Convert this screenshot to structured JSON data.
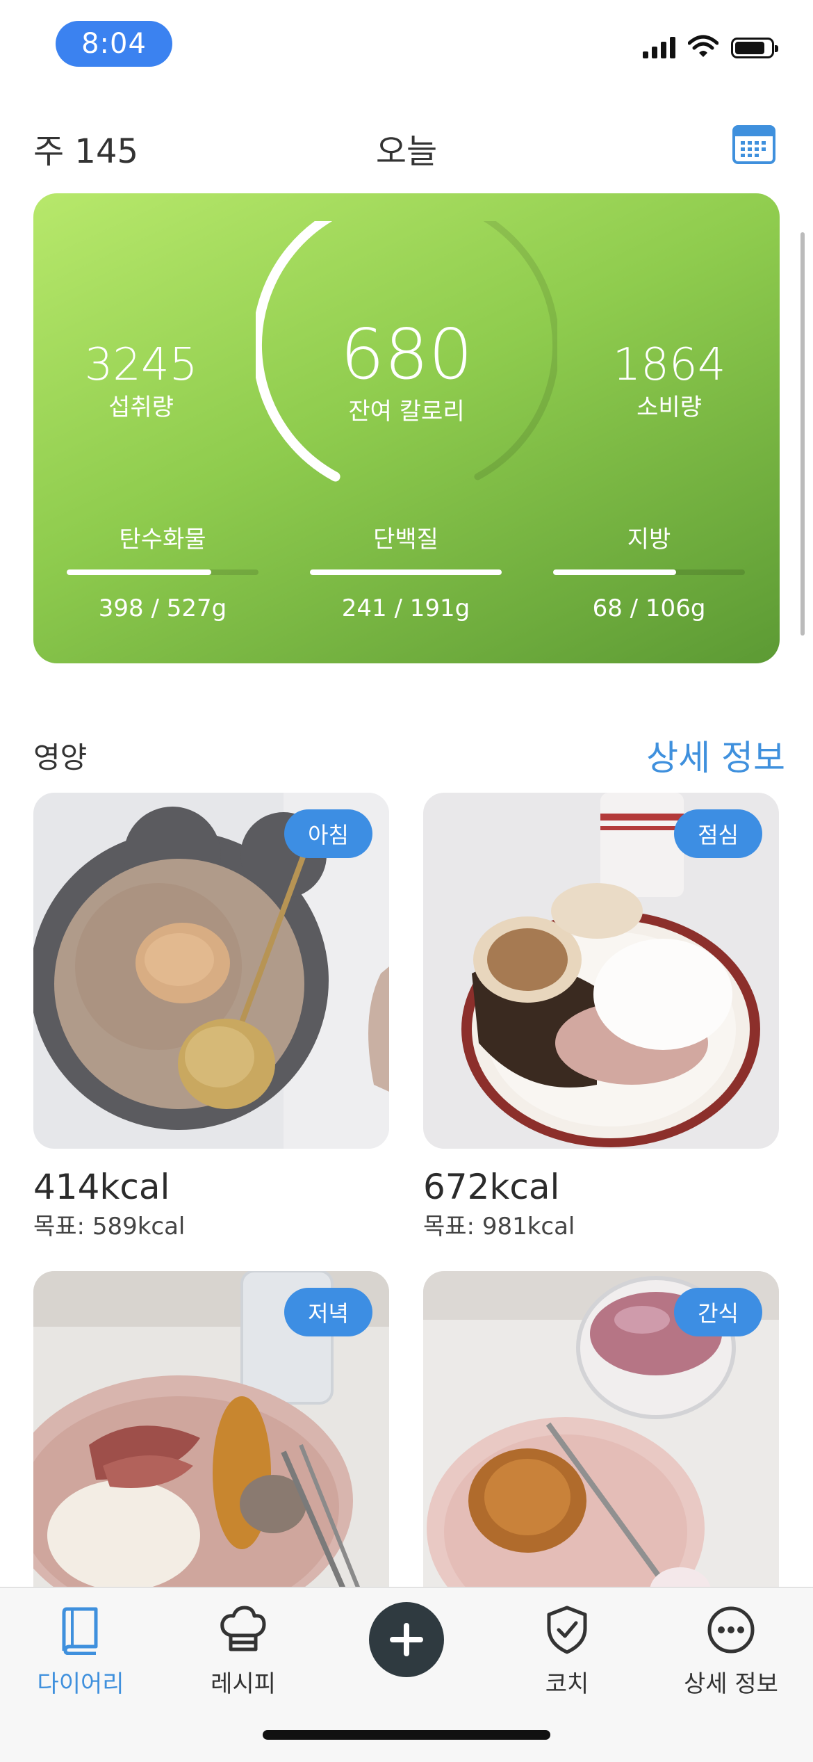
{
  "status": {
    "time": "8:04"
  },
  "header": {
    "week": "주 145",
    "title": "오늘",
    "calendar_icon": "calendar-icon"
  },
  "summary": {
    "intake_value": "3245",
    "intake_label": "섭취량",
    "remaining_value": "680",
    "remaining_label": "잔여 칼로리",
    "burned_value": "1864",
    "burned_label": "소비량",
    "gauge_progress": 0.5,
    "macros": [
      {
        "name": "탄수화물",
        "value": "398 / 527g",
        "progress": 0.755
      },
      {
        "name": "단백질",
        "value": "241 / 191g",
        "progress": 1.0
      },
      {
        "name": "지방",
        "value": "68 / 106g",
        "progress": 0.64
      }
    ]
  },
  "nutrition": {
    "title": "영양",
    "link": "상세 정보",
    "meals": [
      {
        "tag": "아침",
        "kcal": "414kcal",
        "goal": "목표: 589kcal"
      },
      {
        "tag": "점심",
        "kcal": "672kcal",
        "goal": "목표: 981kcal"
      },
      {
        "tag": "저녁"
      },
      {
        "tag": "간식"
      }
    ]
  },
  "tabbar": {
    "items": [
      {
        "label": "다이어리",
        "icon": "book-icon"
      },
      {
        "label": "레시피",
        "icon": "chef-hat-icon"
      },
      {
        "label": "",
        "icon": "plus-icon"
      },
      {
        "label": "코치",
        "icon": "shield-check-icon"
      },
      {
        "label": "상세 정보",
        "icon": "more-icon"
      }
    ]
  },
  "colors": {
    "accent": "#3f90dd",
    "card_start": "#b7e86b",
    "card_end": "#5c9a34",
    "tag": "#3d8ee3"
  }
}
